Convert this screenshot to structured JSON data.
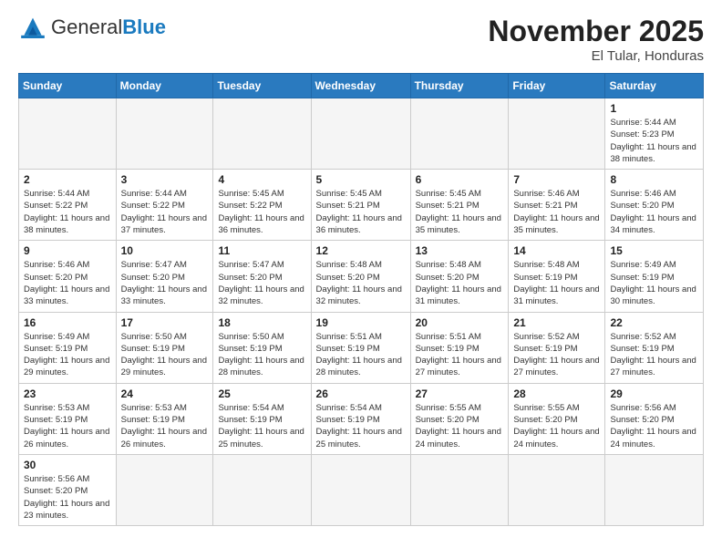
{
  "header": {
    "logo_general": "General",
    "logo_blue": "Blue",
    "month_title": "November 2025",
    "location": "El Tular, Honduras"
  },
  "weekdays": [
    "Sunday",
    "Monday",
    "Tuesday",
    "Wednesday",
    "Thursday",
    "Friday",
    "Saturday"
  ],
  "days": {
    "1": {
      "sunrise": "5:44 AM",
      "sunset": "5:23 PM",
      "daylight": "11 hours and 38 minutes."
    },
    "2": {
      "sunrise": "5:44 AM",
      "sunset": "5:22 PM",
      "daylight": "11 hours and 38 minutes."
    },
    "3": {
      "sunrise": "5:44 AM",
      "sunset": "5:22 PM",
      "daylight": "11 hours and 37 minutes."
    },
    "4": {
      "sunrise": "5:45 AM",
      "sunset": "5:22 PM",
      "daylight": "11 hours and 36 minutes."
    },
    "5": {
      "sunrise": "5:45 AM",
      "sunset": "5:21 PM",
      "daylight": "11 hours and 36 minutes."
    },
    "6": {
      "sunrise": "5:45 AM",
      "sunset": "5:21 PM",
      "daylight": "11 hours and 35 minutes."
    },
    "7": {
      "sunrise": "5:46 AM",
      "sunset": "5:21 PM",
      "daylight": "11 hours and 35 minutes."
    },
    "8": {
      "sunrise": "5:46 AM",
      "sunset": "5:20 PM",
      "daylight": "11 hours and 34 minutes."
    },
    "9": {
      "sunrise": "5:46 AM",
      "sunset": "5:20 PM",
      "daylight": "11 hours and 33 minutes."
    },
    "10": {
      "sunrise": "5:47 AM",
      "sunset": "5:20 PM",
      "daylight": "11 hours and 33 minutes."
    },
    "11": {
      "sunrise": "5:47 AM",
      "sunset": "5:20 PM",
      "daylight": "11 hours and 32 minutes."
    },
    "12": {
      "sunrise": "5:48 AM",
      "sunset": "5:20 PM",
      "daylight": "11 hours and 32 minutes."
    },
    "13": {
      "sunrise": "5:48 AM",
      "sunset": "5:20 PM",
      "daylight": "11 hours and 31 minutes."
    },
    "14": {
      "sunrise": "5:48 AM",
      "sunset": "5:19 PM",
      "daylight": "11 hours and 31 minutes."
    },
    "15": {
      "sunrise": "5:49 AM",
      "sunset": "5:19 PM",
      "daylight": "11 hours and 30 minutes."
    },
    "16": {
      "sunrise": "5:49 AM",
      "sunset": "5:19 PM",
      "daylight": "11 hours and 29 minutes."
    },
    "17": {
      "sunrise": "5:50 AM",
      "sunset": "5:19 PM",
      "daylight": "11 hours and 29 minutes."
    },
    "18": {
      "sunrise": "5:50 AM",
      "sunset": "5:19 PM",
      "daylight": "11 hours and 28 minutes."
    },
    "19": {
      "sunrise": "5:51 AM",
      "sunset": "5:19 PM",
      "daylight": "11 hours and 28 minutes."
    },
    "20": {
      "sunrise": "5:51 AM",
      "sunset": "5:19 PM",
      "daylight": "11 hours and 27 minutes."
    },
    "21": {
      "sunrise": "5:52 AM",
      "sunset": "5:19 PM",
      "daylight": "11 hours and 27 minutes."
    },
    "22": {
      "sunrise": "5:52 AM",
      "sunset": "5:19 PM",
      "daylight": "11 hours and 27 minutes."
    },
    "23": {
      "sunrise": "5:53 AM",
      "sunset": "5:19 PM",
      "daylight": "11 hours and 26 minutes."
    },
    "24": {
      "sunrise": "5:53 AM",
      "sunset": "5:19 PM",
      "daylight": "11 hours and 26 minutes."
    },
    "25": {
      "sunrise": "5:54 AM",
      "sunset": "5:19 PM",
      "daylight": "11 hours and 25 minutes."
    },
    "26": {
      "sunrise": "5:54 AM",
      "sunset": "5:19 PM",
      "daylight": "11 hours and 25 minutes."
    },
    "27": {
      "sunrise": "5:55 AM",
      "sunset": "5:20 PM",
      "daylight": "11 hours and 24 minutes."
    },
    "28": {
      "sunrise": "5:55 AM",
      "sunset": "5:20 PM",
      "daylight": "11 hours and 24 minutes."
    },
    "29": {
      "sunrise": "5:56 AM",
      "sunset": "5:20 PM",
      "daylight": "11 hours and 24 minutes."
    },
    "30": {
      "sunrise": "5:56 AM",
      "sunset": "5:20 PM",
      "daylight": "11 hours and 23 minutes."
    }
  },
  "labels": {
    "sunrise": "Sunrise:",
    "sunset": "Sunset:",
    "daylight": "Daylight:"
  }
}
